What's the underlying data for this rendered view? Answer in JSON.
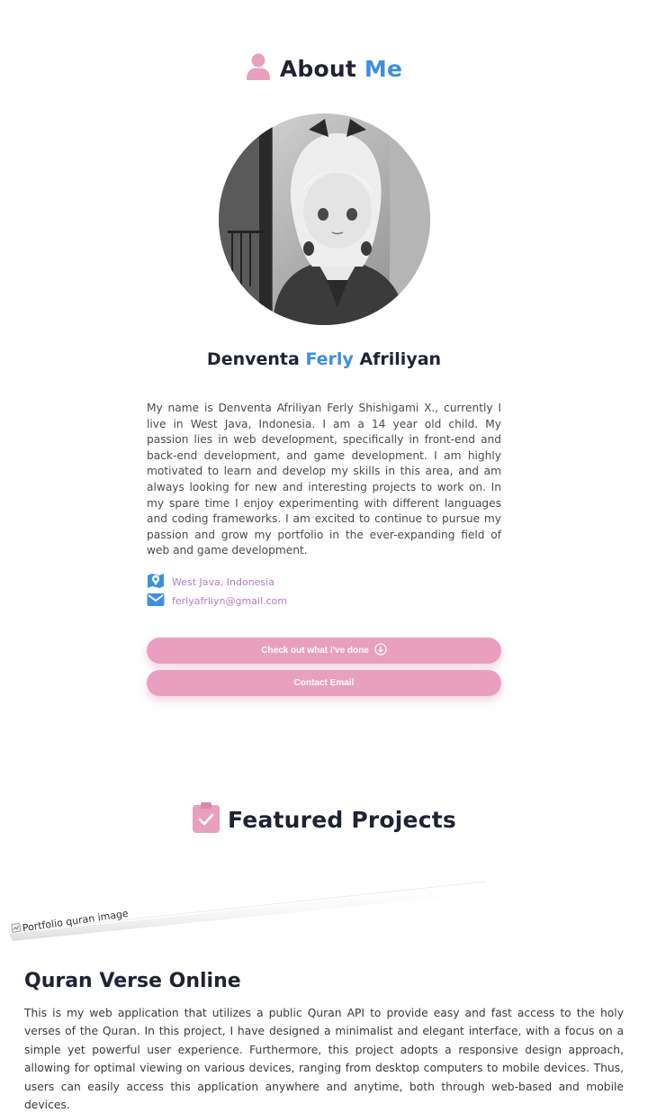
{
  "about": {
    "title_main": "About",
    "title_accent": "Me",
    "icon": "user-icon"
  },
  "profile": {
    "avatar_alt": "Profile picture",
    "name_first": "Denventa",
    "name_middle": "Ferly",
    "name_last": "Afriliyan",
    "bio": "My name is Denventa Afriliyan Ferly Shishigami X., currently I live in West Java, Indonesia. I am a 14 year old child. My passion lies in web development, specifically in front-end and back-end development, and game development. I am highly motivated to learn and develop my skills in this area, and am always looking for new and interesting projects to work on. In my spare time I enjoy experimenting with different languages and coding frameworks. I am excited to continue to pursue my passion and grow my portfolio in the ever-expanding field of web and game development."
  },
  "contact": {
    "location": "West Java, Indonesia",
    "email": "ferlyafrliyn@gmail.com",
    "location_icon": "map-pin-icon",
    "email_icon": "mail-icon"
  },
  "buttons": {
    "work_label": "Check out what i've done",
    "email_label": "Contact Email"
  },
  "projects": {
    "title": "Featured Projects",
    "icon": "clipboard-check-icon",
    "items": [
      {
        "image_alt": "Portfolio quran image",
        "title": "Quran Verse Online",
        "description": "This is my web application that utilizes a public Quran API to provide easy and fast access to the holy verses of the Quran. In this project, I have designed a minimalist and elegant interface, with a focus on a simple yet powerful user experience. Furthermore, this project adopts a responsive design approach, allowing for optimal viewing on various devices, ranging from desktop computers to mobile devices. Thus, users can easily access this application anywhere and anytime, both through web-based and mobile devices."
      }
    ]
  },
  "colors": {
    "accent_blue": "#3d8fe0",
    "accent_pink": "#e9a0bf",
    "link_purple": "#b87ac8",
    "heading_dark": "#1f2333"
  }
}
